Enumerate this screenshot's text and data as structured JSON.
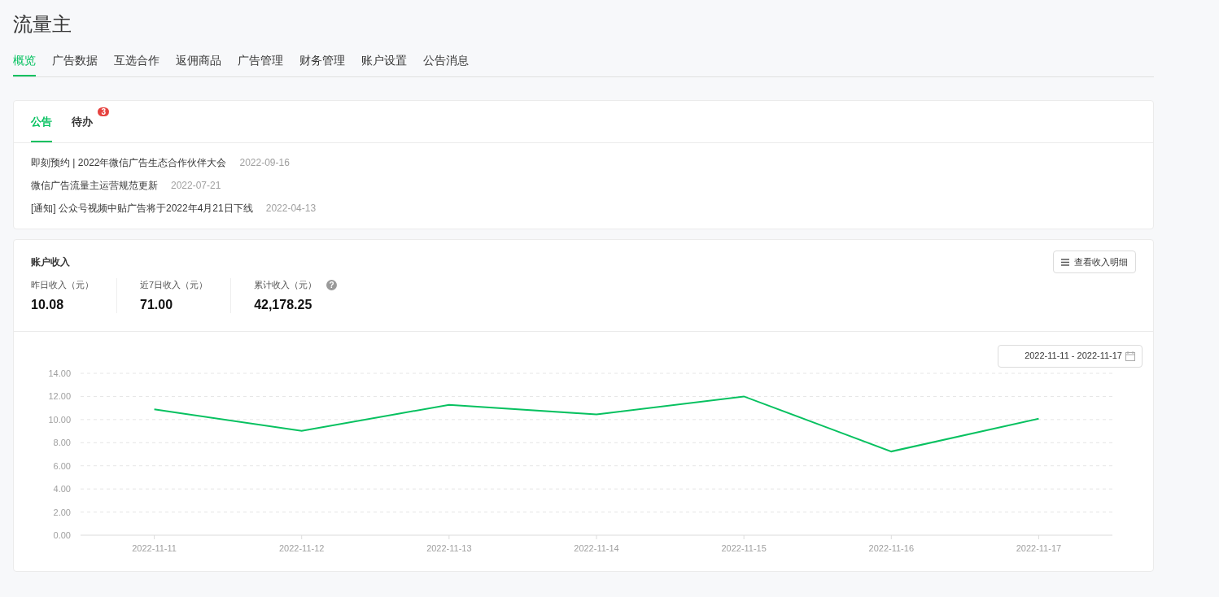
{
  "page_title": "流量主",
  "nav_tabs": [
    {
      "label": "概览",
      "selected": true
    },
    {
      "label": "广告数据",
      "selected": false
    },
    {
      "label": "互选合作",
      "selected": false
    },
    {
      "label": "返佣商品",
      "selected": false
    },
    {
      "label": "广告管理",
      "selected": false
    },
    {
      "label": "财务管理",
      "selected": false
    },
    {
      "label": "账户设置",
      "selected": false
    },
    {
      "label": "公告消息",
      "selected": false
    }
  ],
  "notice_card": {
    "tabs": [
      {
        "label": "公告",
        "selected": true
      },
      {
        "label": "待办",
        "selected": false,
        "badge": "3"
      }
    ],
    "items": [
      {
        "title": "即刻预约 | 2022年微信广告生态合作伙伴大会",
        "date": "2022-09-16"
      },
      {
        "title": "微信广告流量主运营规范更新",
        "date": "2022-07-21"
      },
      {
        "title": "[通知] 公众号视频中贴广告将于2022年4月21日下线",
        "date": "2022-04-13"
      }
    ]
  },
  "income_card": {
    "title": "账户收入",
    "detail_button": "查看收入明细",
    "stats": [
      {
        "label": "昨日收入（元）",
        "value": "10.08"
      },
      {
        "label": "近7日收入（元）",
        "value": "71.00"
      },
      {
        "label": "累计收入（元）",
        "value": "42,178.25",
        "help_icon": "?"
      }
    ],
    "date_range": "2022-11-11 - 2022-11-17",
    "chart_data": {
      "type": "line",
      "categories": [
        "2022-11-11",
        "2022-11-12",
        "2022-11-13",
        "2022-11-14",
        "2022-11-15",
        "2022-11-16",
        "2022-11-17"
      ],
      "grid": true,
      "series": [
        {
          "color": "#07c160",
          "values": [
            10.88,
            9.02,
            11.28,
            10.44,
            12.0,
            7.24,
            10.08
          ]
        }
      ],
      "ylim": [
        0,
        14
      ],
      "yticks": [
        {
          "value": 0,
          "label": "0.00"
        },
        {
          "value": 2,
          "label": "2.00"
        },
        {
          "value": 4,
          "label": "4.00"
        },
        {
          "value": 6,
          "label": "6.00"
        },
        {
          "value": 8,
          "label": "8.00"
        },
        {
          "value": 10,
          "label": "10.00"
        },
        {
          "value": 12,
          "label": "12.00"
        },
        {
          "value": 14,
          "label": "14.00"
        }
      ]
    }
  }
}
